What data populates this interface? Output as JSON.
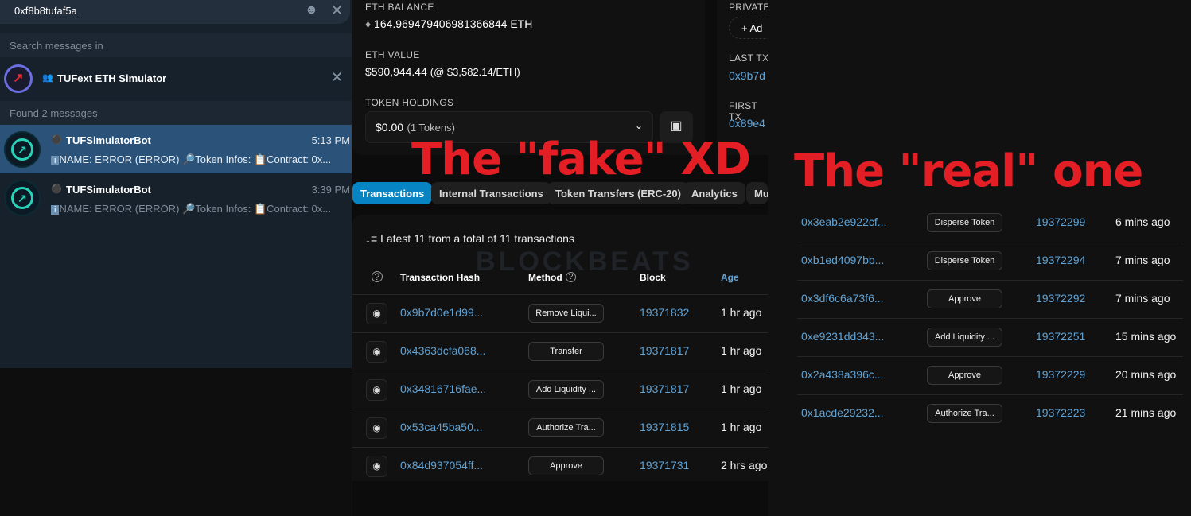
{
  "telegram": {
    "search_value": "0xf8b8tufaf5a",
    "search_in_label": "Search messages in",
    "chat_name": "TUFext ETH Simulator",
    "found_label": "Found 2 messages",
    "messages": [
      {
        "sender": "TUFSimulatorBot",
        "time": "5:13 PM",
        "name_text": "NAME: ERROR (ERROR)",
        "token_text": "Token Infos:",
        "contract_text": "Contract: 0x...",
        "selected": true
      },
      {
        "sender": "TUFSimulatorBot",
        "time": "3:39 PM",
        "name_text": "NAME: ERROR (ERROR)",
        "token_text": "Token Infos:",
        "contract_text": "Contract: 0x...",
        "selected": false
      }
    ]
  },
  "overview": {
    "eth_balance_label": "ETH BALANCE",
    "eth_balance": "164.969479406981366844 ETH",
    "eth_value_label": "ETH VALUE",
    "eth_value": "$590,944.44",
    "eth_price": "(@ $3,582.14/ETH)",
    "token_holdings_label": "TOKEN HOLDINGS",
    "token_value": "$0.00",
    "token_count": "(1 Tokens)",
    "private_label": "PRIVATE",
    "add_label": "+ Ad",
    "last_tx_label": "LAST TX",
    "last_tx": "0x9b7d",
    "first_tx_label": "FIRST TX",
    "first_tx": "0x89e4"
  },
  "annotations": {
    "fake": "The \"fake\" XD",
    "real": "The \"real\" one"
  },
  "watermark": "BLOCKBEATS",
  "tabs": [
    "Transactions",
    "Internal Transactions",
    "Token Transfers (ERC-20)",
    "Analytics",
    "Mu"
  ],
  "fake_table": {
    "summary": "Latest 11 from a total of 11 transactions",
    "headers": {
      "hash": "Transaction Hash",
      "method": "Method",
      "block": "Block",
      "age": "Age"
    },
    "rows": [
      {
        "hash": "0x9b7d0e1d99...",
        "method": "Remove Liqui...",
        "block": "19371832",
        "age": "1 hr ago"
      },
      {
        "hash": "0x4363dcfa068...",
        "method": "Transfer",
        "block": "19371817",
        "age": "1 hr ago"
      },
      {
        "hash": "0x34816716fae...",
        "method": "Add Liquidity ...",
        "block": "19371817",
        "age": "1 hr ago"
      },
      {
        "hash": "0x53ca45ba50...",
        "method": "Authorize Tra...",
        "block": "19371815",
        "age": "1 hr ago"
      },
      {
        "hash": "0x84d937054ff...",
        "method": "Approve",
        "block": "19371731",
        "age": "2 hrs ago"
      }
    ]
  },
  "real_table": {
    "rows": [
      {
        "hash": "0x3eab2e922cf...",
        "method": "Disperse Token",
        "block": "19372299",
        "age": "6 mins ago"
      },
      {
        "hash": "0xb1ed4097bb...",
        "method": "Disperse Token",
        "block": "19372294",
        "age": "7 mins ago"
      },
      {
        "hash": "0x3df6c6a73f6...",
        "method": "Approve",
        "block": "19372292",
        "age": "7 mins ago"
      },
      {
        "hash": "0xe9231dd343...",
        "method": "Add Liquidity ...",
        "block": "19372251",
        "age": "15 mins ago"
      },
      {
        "hash": "0x2a438a396c...",
        "method": "Approve",
        "block": "19372229",
        "age": "20 mins ago"
      },
      {
        "hash": "0x1acde29232...",
        "method": "Authorize Tra...",
        "block": "19372223",
        "age": "21 mins ago"
      }
    ]
  }
}
